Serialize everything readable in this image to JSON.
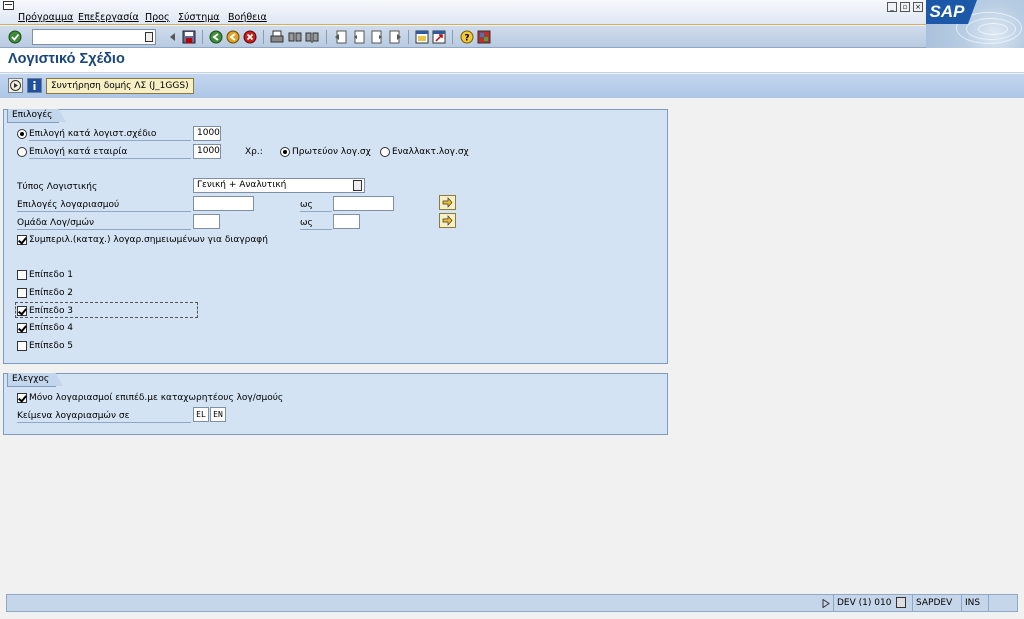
{
  "menu": {
    "items": [
      "Πρόγραμμα",
      "Επεξεργασία",
      "Προς",
      "Σύστημα",
      "Βοήθεια"
    ]
  },
  "logo": {
    "text": "SAP"
  },
  "toolbar": {
    "command_value": "",
    "icons": [
      "enter-icon",
      "back-small-icon",
      "save-icon",
      "back-icon",
      "exit-icon",
      "cancel-icon",
      "print-icon",
      "find-icon",
      "find-next-icon",
      "first-page-icon",
      "previous-page-icon",
      "next-page-icon",
      "last-page-icon",
      "new-session-icon",
      "shortcut-icon",
      "help-icon",
      "layout-icon"
    ]
  },
  "title": "Λογιστικό Σχέδιο",
  "app_toolbar": {
    "struct_button": "Συντήρηση δομής ΛΣ (J_1GGS)"
  },
  "options_group": {
    "title": "Επιλογές",
    "radio_chart": {
      "label": "Επιλογή κατά λογιστ.σχέδιο",
      "value": "1000",
      "selected": true
    },
    "radio_company": {
      "label": "Επιλογή κατά εταιρία",
      "value": "1000",
      "selected": false
    },
    "chart_type_label": "Χρ.:",
    "primary_chart": {
      "label": "Πρωτεύον λογ.σχ",
      "selected": true
    },
    "alt_chart": {
      "label": "Εναλλακτ.λογ.σχ",
      "selected": false
    },
    "accounting_type": {
      "label": "Τύπος Λογιστικής",
      "value": "Γενική + Αναλυτική"
    },
    "account_selection": {
      "label": "Επιλογές λογαριασμού",
      "from": "",
      "to_label": "ως",
      "to": ""
    },
    "account_group": {
      "label": "Ομάδα Λογ/σμών",
      "from": "",
      "to_label": "ως",
      "to": ""
    },
    "include_deleted": {
      "label": "Συμπεριλ.(καταχ.) λογαρ.σημειωμένων για διαγραφή",
      "checked": true
    },
    "levels": [
      {
        "label": "Επίπεδο 1",
        "checked": false
      },
      {
        "label": "Επίπεδο 2",
        "checked": false
      },
      {
        "label": "Επίπεδο 3",
        "checked": true
      },
      {
        "label": "Επίπεδο 4",
        "checked": true
      },
      {
        "label": "Επίπεδο 5",
        "checked": false
      }
    ]
  },
  "control_group": {
    "title": "Ελεγχος",
    "only_posting": {
      "label": "Μόνο λογαριασμοί επιπέδ.με καταχωρητέους λογ/σμούς",
      "checked": true
    },
    "texts_in": {
      "label": "Κείμενα λογαριασμών σε",
      "lang1": "EL",
      "lang2": "EN"
    }
  },
  "status": {
    "system": "DEV (1) 010",
    "server": "SAPDEV",
    "mode": "INS"
  }
}
